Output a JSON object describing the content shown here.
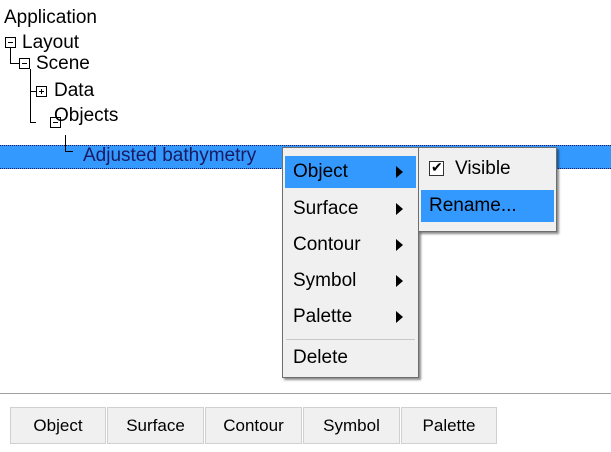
{
  "tree": {
    "application": "Application",
    "layout": "Layout",
    "scene": "Scene",
    "data": "Data",
    "objects": "Objects",
    "selected_item": "Adjusted bathymetry"
  },
  "context_menu": {
    "items": [
      {
        "label": "Object",
        "has_submenu": true,
        "highlighted": true
      },
      {
        "label": "Surface",
        "has_submenu": true
      },
      {
        "label": "Contour",
        "has_submenu": true
      },
      {
        "label": "Symbol",
        "has_submenu": true
      },
      {
        "label": "Palette",
        "has_submenu": true
      },
      {
        "label": "Delete",
        "has_submenu": false
      }
    ]
  },
  "submenu": {
    "visible_label": "Visible",
    "visible_checked": true,
    "check_glyph": "✔",
    "rename_label": "Rename..."
  },
  "tabs": [
    "Object",
    "Surface",
    "Contour",
    "Symbol",
    "Palette"
  ],
  "colors": {
    "selection": "#3399ff",
    "menu_bg": "#f0f0f0"
  }
}
